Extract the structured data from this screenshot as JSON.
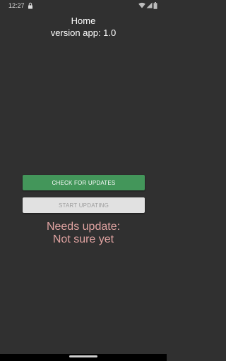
{
  "status_bar": {
    "time": "12:27",
    "icons": [
      "lock-icon",
      "wifi-icon",
      "signal-icon",
      "battery-icon"
    ]
  },
  "header": {
    "title": "Home",
    "version": "version app: 1.0"
  },
  "buttons": {
    "check_label": "CHECK FOR UPDATES",
    "start_label": "START UPDATING"
  },
  "status": {
    "line1": "Needs update:",
    "line2": "Not sure yet"
  },
  "colors": {
    "background": "#303030",
    "check_button": "#43965a",
    "start_button": "#e1e1e1",
    "status_text": "#e0a3a1"
  }
}
